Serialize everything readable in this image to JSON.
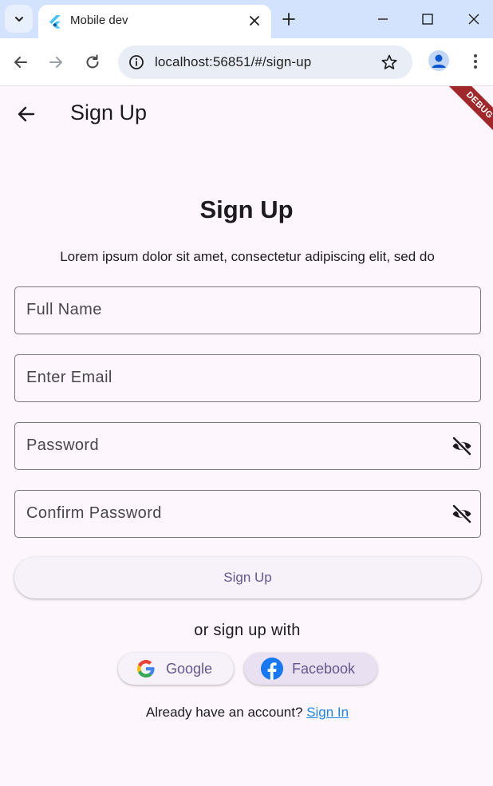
{
  "browser": {
    "tab_title": "Mobile dev",
    "url": "localhost:56851/#/sign-up"
  },
  "app": {
    "appbar_title": "Sign Up",
    "debug_banner": "DEBUG",
    "heading": "Sign Up",
    "subtitle": "Lorem ipsum dolor sit amet, consectetur adipiscing elit, sed do",
    "fields": {
      "full_name": "Full Name",
      "email": "Enter Email",
      "password": "Password",
      "confirm_password": "Confirm Password"
    },
    "signup_button": "Sign Up",
    "or_text": "or sign up with",
    "google_label": "Google",
    "facebook_label": "Facebook",
    "have_account": "Already have an account?",
    "signin_link": "Sign In"
  },
  "colors": {
    "tabbar_bg": "#d3e3fd",
    "app_bg": "#fdf7fd",
    "accent_text": "#65558f",
    "link": "#1e88e5",
    "debug_ribbon": "#a0282a"
  }
}
